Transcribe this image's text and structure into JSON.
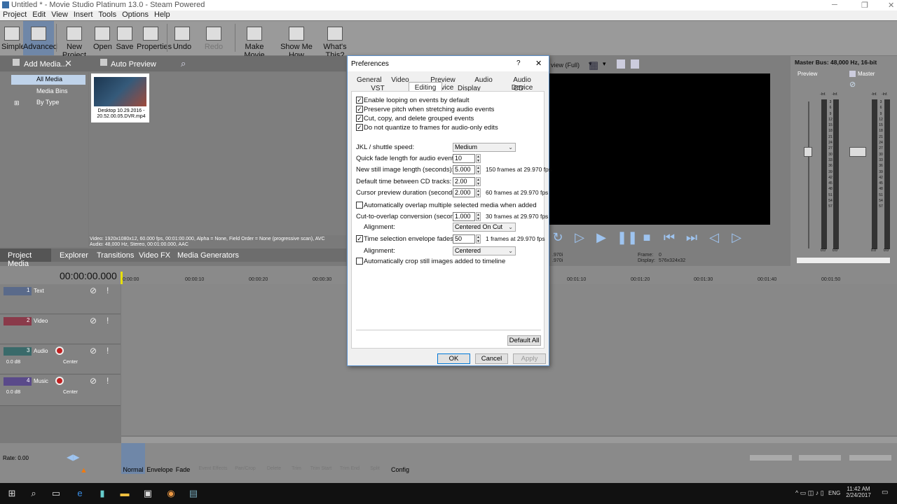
{
  "window": {
    "title": "Untitled * - Movie Studio Platinum 13.0 - Steam Powered"
  },
  "menu": [
    "Project",
    "Edit",
    "View",
    "Insert",
    "Tools",
    "Options",
    "Help"
  ],
  "toolbar": {
    "simple": "Simple",
    "advanced": "Advanced",
    "new_project": "New Project",
    "open": "Open",
    "save": "Save",
    "properties": "Properties",
    "undo": "Undo",
    "redo": "Redo",
    "make_movie": "Make Movie",
    "show_me_how": "Show Me How",
    "whats_this": "What's This?"
  },
  "media": {
    "add_media": "Add Media...",
    "auto_preview": "Auto Preview",
    "tree": [
      "All Media",
      "Media Bins",
      "By Type"
    ],
    "thumb_caption": "Desktop 10.29.2016 - 20.52.00.05.DVR.mp4",
    "info_line1": "Video: 1920x1080x12, 60.000 fps, 00:01:00.000, Alpha = None, Field Order = None (progressive scan), AVC",
    "info_line2": "Audio: 48,000 Hz, Stereo, 00:01:00.000, AAC",
    "tabs": [
      "Project Media",
      "Explorer",
      "Transitions",
      "Video FX",
      "Media Generators"
    ]
  },
  "preview": {
    "view_label": "view (Full)",
    "frame_label": "Frame:",
    "frame_value": "0",
    "display_label": "Display:",
    "display_value": "576x324x32",
    "left_a": ".970i",
    "left_b": ".970i"
  },
  "master": {
    "title": "Master Bus: 48,000 Hz, 16-bit",
    "preview": "Preview",
    "master": "Master",
    "inf": "-Inf.",
    "db_scale": [
      "3",
      "6",
      "9",
      "12",
      "15",
      "18",
      "21",
      "24",
      "27",
      "30",
      "33",
      "36",
      "39",
      "42",
      "45",
      "48",
      "51",
      "54",
      "57"
    ],
    "zero": "0.0"
  },
  "timeline": {
    "time": "00:00:00.000",
    "ruler": [
      "0:00:00",
      "00:00:10",
      "00:00:20",
      "00:00:30",
      "00:01:10",
      "00:01:20",
      "00:01:30",
      "00:01:40",
      "00:01:50"
    ],
    "tracks": [
      {
        "num": "1",
        "name": "Text"
      },
      {
        "num": "2",
        "name": "Video"
      },
      {
        "num": "3",
        "name": "Audio",
        "vol": "0.0 dB",
        "pan": "Center"
      },
      {
        "num": "4",
        "name": "Music",
        "vol": "0.0 dB",
        "pan": "Center"
      }
    ],
    "rate": "Rate: 0.00"
  },
  "bottom": {
    "normal": "Normal",
    "envelope": "Envelope",
    "fade": "Fade",
    "pan_effects": "Pan/Crop",
    "event_fx": "Event Effects",
    "delete": "Delete",
    "trim": "Trim",
    "trim_start": "Trim Start",
    "trim_end": "Trim End",
    "split": "Split",
    "config": "Config"
  },
  "dialog": {
    "title": "Preferences",
    "help": "?",
    "close": "✕",
    "tabs_row1": [
      "General",
      "Video",
      "Preview Device",
      "Audio",
      "Audio Device"
    ],
    "tabs_row2": [
      "VST Effects",
      "Editing",
      "Display",
      "CD Settings"
    ],
    "checks": [
      "Enable looping on events by default",
      "Preserve pitch when stretching audio events",
      "Cut, copy, and delete grouped events",
      "Do not quantize to frames for audio-only edits"
    ],
    "jkl_label": "JKL / shuttle speed:",
    "jkl_value": "Medium",
    "fade_label": "Quick fade length for audio events (ms):",
    "fade_value": "10",
    "still_label": "New still image length (seconds):",
    "still_value": "5.000",
    "still_note": "150 frames at 29.970 fps",
    "cd_label": "Default time between CD tracks:",
    "cd_value": "2.00",
    "cursor_label": "Cursor preview duration (seconds):",
    "cursor_value": "2.000",
    "cursor_note": "60 frames at 29.970 fps",
    "overlap_check": "Automatically overlap multiple selected media when added",
    "cto_label": "Cut-to-overlap conversion (seconds):",
    "cto_value": "1.000",
    "cto_note": "30 frames at 29.970 fps",
    "align_label": "Alignment:",
    "align_value": "Centered On Cut",
    "tsef_check": "Time selection envelope fades (ms):",
    "tsef_value": "50",
    "tsef_note": "1 frames at 29.970 fps",
    "align2_label": "Alignment:",
    "align2_value": "Centered",
    "crop_check": "Automatically crop still images added to timeline",
    "default_all": "Default All",
    "ok": "OK",
    "cancel": "Cancel",
    "apply": "Apply"
  },
  "taskbar": {
    "lang": "ENG",
    "time": "11:42 AM",
    "date": "2/24/2017"
  }
}
